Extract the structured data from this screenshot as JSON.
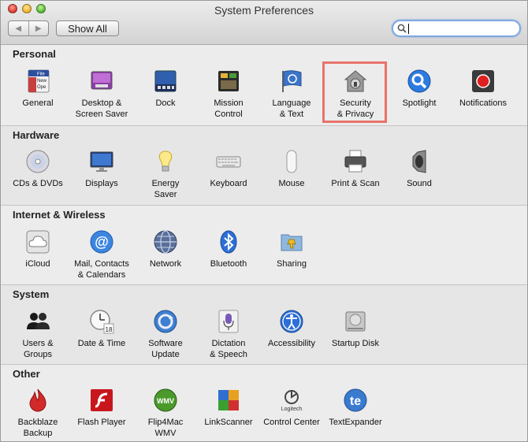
{
  "window": {
    "title": "System Preferences"
  },
  "toolbar": {
    "back_label": "◀",
    "forward_label": "▶",
    "show_all_label": "Show All",
    "search_value": "",
    "search_placeholder": ""
  },
  "sections": [
    {
      "title": "Personal",
      "items": [
        {
          "label": "General"
        },
        {
          "label": "Desktop &\nScreen Saver"
        },
        {
          "label": "Dock"
        },
        {
          "label": "Mission\nControl"
        },
        {
          "label": "Language\n& Text"
        },
        {
          "label": "Security\n& Privacy"
        },
        {
          "label": "Spotlight"
        },
        {
          "label": "Notifications"
        }
      ]
    },
    {
      "title": "Hardware",
      "items": [
        {
          "label": "CDs & DVDs"
        },
        {
          "label": "Displays"
        },
        {
          "label": "Energy\nSaver"
        },
        {
          "label": "Keyboard"
        },
        {
          "label": "Mouse"
        },
        {
          "label": "Print & Scan"
        },
        {
          "label": "Sound"
        }
      ]
    },
    {
      "title": "Internet & Wireless",
      "items": [
        {
          "label": "iCloud"
        },
        {
          "label": "Mail, Contacts\n& Calendars"
        },
        {
          "label": "Network"
        },
        {
          "label": "Bluetooth"
        },
        {
          "label": "Sharing"
        }
      ]
    },
    {
      "title": "System",
      "items": [
        {
          "label": "Users &\nGroups"
        },
        {
          "label": "Date & Time"
        },
        {
          "label": "Software\nUpdate"
        },
        {
          "label": "Dictation\n& Speech"
        },
        {
          "label": "Accessibility"
        },
        {
          "label": "Startup Disk"
        }
      ]
    },
    {
      "title": "Other",
      "items": [
        {
          "label": "Backblaze\nBackup"
        },
        {
          "label": "Flash Player"
        },
        {
          "label": "Flip4Mac\nWMV"
        },
        {
          "label": "LinkScanner"
        },
        {
          "label": "Control Center"
        },
        {
          "label": "TextExpander"
        }
      ]
    }
  ],
  "icon_text": {
    "general_file": "File",
    "general_new": "New",
    "general_open": "Ope",
    "date_day": "18",
    "flip_wmv": "WMV",
    "logitech": "Logitech",
    "te": "te"
  },
  "highlight": {
    "item": "Security & Privacy",
    "color": "#e8736b"
  }
}
